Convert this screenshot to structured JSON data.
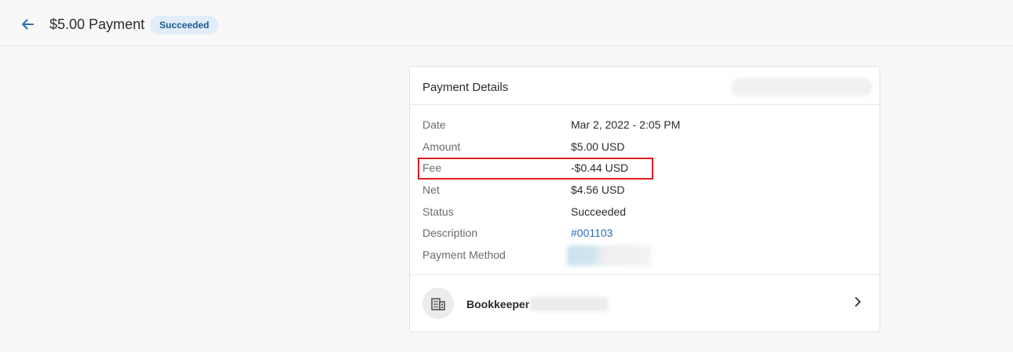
{
  "header": {
    "title": "$5.00 Payment",
    "status_badge": "Succeeded",
    "back_icon": "arrow-left-icon"
  },
  "payment_details": {
    "title": "Payment Details",
    "rows": [
      {
        "label": "Date",
        "value": "Mar 2, 2022 - 2:05 PM"
      },
      {
        "label": "Amount",
        "value": "$5.00 USD"
      },
      {
        "label": "Fee",
        "value": "-$0.44 USD"
      },
      {
        "label": "Net",
        "value": "$4.56 USD"
      },
      {
        "label": "Status",
        "value": "Succeeded"
      },
      {
        "label": "Description",
        "value": "#001103"
      },
      {
        "label": "Payment Method",
        "value": ""
      }
    ]
  },
  "footer": {
    "org_label": "Bookkeeper",
    "org_icon": "building-icon",
    "chevron_icon": "chevron-right-icon"
  },
  "colors": {
    "accent": "#2a6db5",
    "badge_bg": "#e1eef9",
    "badge_text": "#1b5a8e",
    "highlight": "#e01b1b"
  }
}
